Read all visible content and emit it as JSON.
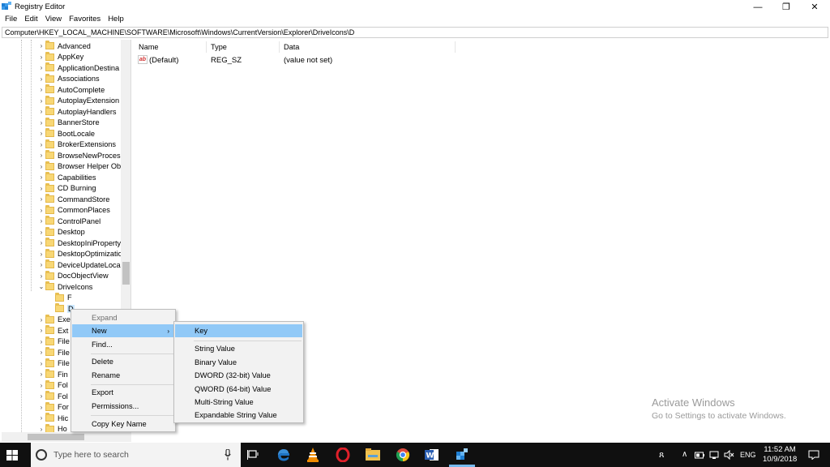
{
  "window": {
    "title": "Registry Editor",
    "minimize_glyph": "—",
    "maximize_glyph": "❐",
    "close_glyph": "✕"
  },
  "menu": [
    "File",
    "Edit",
    "View",
    "Favorites",
    "Help"
  ],
  "address": "Computer\\HKEY_LOCAL_MACHINE\\SOFTWARE\\Microsoft\\Windows\\CurrentVersion\\Explorer\\DriveIcons\\D",
  "tree": {
    "items": [
      "Advanced",
      "AppKey",
      "ApplicationDestina",
      "Associations",
      "AutoComplete",
      "AutoplayExtension",
      "AutoplayHandlers",
      "BannerStore",
      "BootLocale",
      "BrokerExtensions",
      "BrowseNewProces",
      "Browser Helper Ob",
      "Capabilities",
      "CD Burning",
      "CommandStore",
      "CommonPlaces",
      "ControlPanel",
      "Desktop",
      "DesktopIniProperty",
      "DesktopOptimizatio",
      "DeviceUpdateLoca",
      "DocObjectView",
      "DriveIcons"
    ],
    "children": [
      "F",
      "D"
    ],
    "after": [
      "Exe",
      "Ext",
      "File",
      "File",
      "File",
      "Fin",
      "Fol",
      "Fol",
      "For",
      "Hic",
      "Ho"
    ]
  },
  "list": {
    "columns": [
      "Name",
      "Type",
      "Data"
    ],
    "rows": [
      {
        "name": "(Default)",
        "type": "REG_SZ",
        "data": "(value not set)",
        "icon": "ab-string-icon"
      }
    ]
  },
  "context_menu": {
    "expand": "Expand",
    "new": "New",
    "new_arrow": "›",
    "find": "Find...",
    "delete": "Delete",
    "rename": "Rename",
    "export": "Export",
    "permissions": "Permissions...",
    "copy_key_name": "Copy Key Name"
  },
  "new_submenu": {
    "key": "Key",
    "string_value": "String Value",
    "binary_value": "Binary Value",
    "dword_value": "DWORD (32-bit) Value",
    "qword_value": "QWORD (64-bit) Value",
    "multi_string_value": "Multi-String Value",
    "expandable_string_value": "Expandable String Value"
  },
  "watermark": {
    "title": "Activate Windows",
    "subtitle": "Go to Settings to activate Windows."
  },
  "taskbar": {
    "search_placeholder": "Type here to search",
    "tray_people": "ጸ",
    "tray_chevron": "∧",
    "tray_lang": "ENG",
    "clock_time": "11:52 AM",
    "clock_date": "10/9/2018",
    "accent_color": "#76b9ed"
  }
}
